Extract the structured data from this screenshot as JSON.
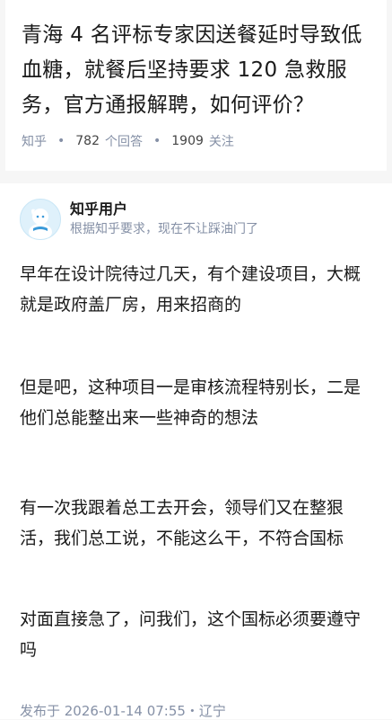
{
  "question": {
    "title": "青海 4 名评标专家因送餐延时导致低血糖，就餐后坚持要求 120 急救服务，官方通报解聘，如何评价？",
    "source": "知乎",
    "answer_count": "782",
    "answer_label": "个回答",
    "follower_count": "1909",
    "follower_label": "关注"
  },
  "answer": {
    "author_name": "知乎用户",
    "author_headline": "根据知乎要求，现在不让踩油门了",
    "avatar_icon": "default-user-avatar-icon",
    "paragraphs": [
      "早年在设计院待过几天，有个建设项目，大概就是政府盖厂房，用来招商的",
      "但是吧，这种项目一是审核流程特别长，二是他们总能整出来一些神奇的想法",
      "有一次我跟着总工去开会，领导们又在整狠活，我们总工说，不能这么干，不符合国标",
      "对面直接急了，问我们，这个国标必须要遵守吗"
    ],
    "publish_info": "发布于 2026-01-14 07:55・辽宁"
  },
  "colors": {
    "meta_gray": "#8590a6",
    "text": "#1a1a1a",
    "background": "#f6f6f6",
    "avatar_bg": "#dff1fb"
  }
}
